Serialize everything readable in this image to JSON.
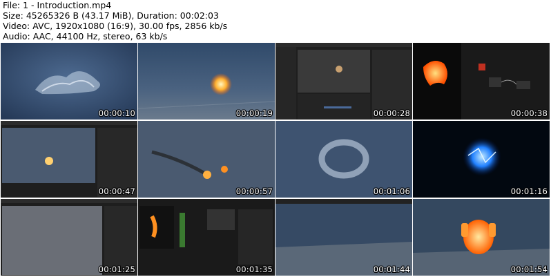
{
  "header": {
    "file_line": "File: 1 - Introduction.mp4",
    "size_line": "Size: 45265326 B (43.17 MiB), Duration: 00:02:03",
    "video_line": "Video: AVC, 1920x1080 (16:9), 30.00 fps, 2856 kb/s",
    "audio_line": "Audio: AAC, 44100 Hz, stereo, 63 kb/s"
  },
  "thumbnails": [
    {
      "time": "00:00:10"
    },
    {
      "time": "00:00:19"
    },
    {
      "time": "00:00:28"
    },
    {
      "time": "00:00:38"
    },
    {
      "time": "00:00:47"
    },
    {
      "time": "00:00:57"
    },
    {
      "time": "00:01:06"
    },
    {
      "time": "00:01:16"
    },
    {
      "time": "00:01:25"
    },
    {
      "time": "00:01:35"
    },
    {
      "time": "00:01:44"
    },
    {
      "time": "00:01:54"
    }
  ]
}
